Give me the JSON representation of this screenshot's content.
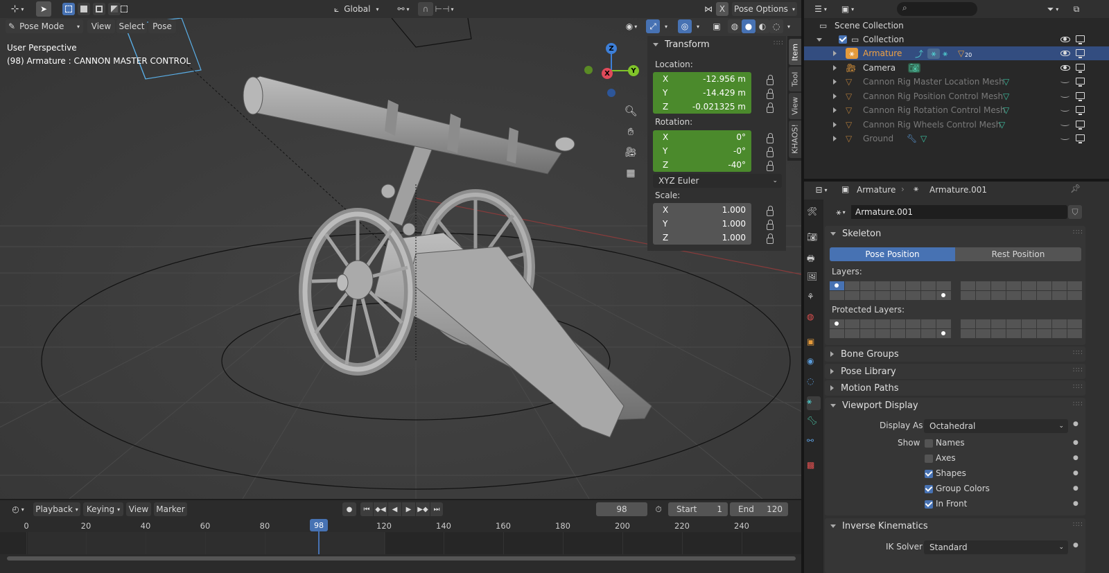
{
  "topbar": {
    "transform_orientation": "Global",
    "pose_options": "Pose Options",
    "x_label": "X"
  },
  "viewport_header": {
    "mode": "Pose Mode",
    "menus": [
      "View",
      "Select",
      "Pose"
    ]
  },
  "viewport": {
    "perspective": "User Perspective",
    "object_info": "(98) Armature : CANNON MASTER CONTROL",
    "gizmo": {
      "x": "X",
      "y": "Y",
      "z": "Z"
    }
  },
  "npanel": {
    "tabs": [
      "Item",
      "Tool",
      "View",
      "KHAOS!"
    ],
    "title": "Transform",
    "location_label": "Location:",
    "location": [
      {
        "axis": "X",
        "value": "-12.956 m"
      },
      {
        "axis": "Y",
        "value": "-14.429 m"
      },
      {
        "axis": "Z",
        "value": "-0.021325 m"
      }
    ],
    "rotation_label": "Rotation:",
    "rotation": [
      {
        "axis": "X",
        "value": "0°"
      },
      {
        "axis": "Y",
        "value": "-0°"
      },
      {
        "axis": "Z",
        "value": "-40°"
      }
    ],
    "rotation_mode": "XYZ Euler",
    "scale_label": "Scale:",
    "scale": [
      {
        "axis": "X",
        "value": "1.000"
      },
      {
        "axis": "Y",
        "value": "1.000"
      },
      {
        "axis": "Z",
        "value": "1.000"
      }
    ]
  },
  "outliner": {
    "scene_collection": "Scene Collection",
    "items": [
      {
        "name": "Collection"
      },
      {
        "name": "Armature",
        "badge": "20"
      },
      {
        "name": "Camera"
      },
      {
        "name": "Cannon Rig Master Location Mesh"
      },
      {
        "name": "Cannon Rig Position Control Mesh"
      },
      {
        "name": "Cannon Rig Rotation Control Mesh"
      },
      {
        "name": "Cannon Rig Wheels Control Mesh"
      },
      {
        "name": "Ground"
      }
    ]
  },
  "properties": {
    "breadcrumb_object": "Armature",
    "breadcrumb_data": "Armature.001",
    "datablock": "Armature.001",
    "skeleton": {
      "title": "Skeleton",
      "pose_position": "Pose Position",
      "rest_position": "Rest Position",
      "layers_label": "Layers:",
      "protected_label": "Protected Layers:"
    },
    "collapsed_panels": [
      "Bone Groups",
      "Pose Library",
      "Motion Paths"
    ],
    "viewport_display": {
      "title": "Viewport Display",
      "display_as_label": "Display As",
      "display_as": "Octahedral",
      "show_label": "Show",
      "options": [
        {
          "label": "Names",
          "checked": false
        },
        {
          "label": "Axes",
          "checked": false
        },
        {
          "label": "Shapes",
          "checked": true
        },
        {
          "label": "Group Colors",
          "checked": true
        },
        {
          "label": "In Front",
          "checked": true
        }
      ]
    },
    "ik": {
      "title": "Inverse Kinematics",
      "solver_label": "IK Solver",
      "solver": "Standard"
    }
  },
  "timeline": {
    "menus": [
      "Playback",
      "Keying",
      "View",
      "Marker"
    ],
    "current_frame": "98",
    "start_label": "Start",
    "start": "1",
    "end_label": "End",
    "end": "120",
    "ticks": [
      "0",
      "20",
      "40",
      "60",
      "80",
      "120",
      "140",
      "160",
      "180",
      "200",
      "220",
      "240"
    ],
    "playhead": "98"
  }
}
